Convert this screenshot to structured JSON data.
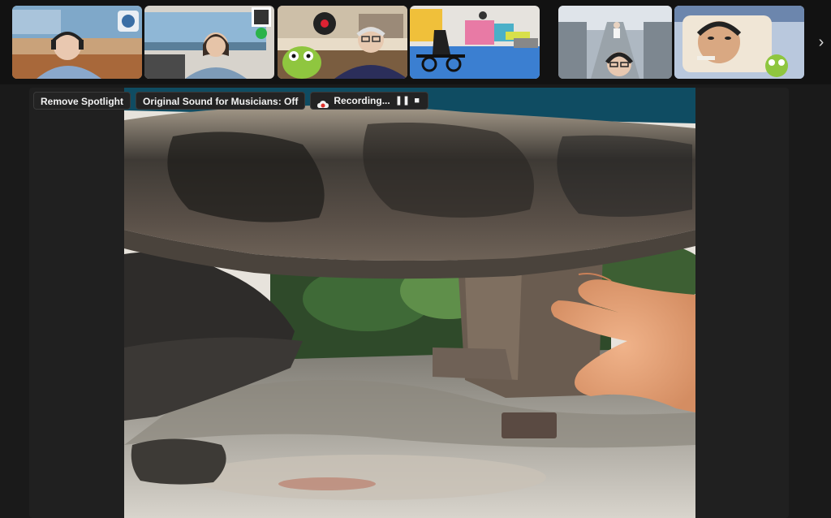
{
  "toolbar": {
    "spotlight_label": "Remove Spotlight",
    "original_sound_label": "Original Sound for Musicians: Off",
    "recording_label": "Recording...",
    "pause_symbol": "❚❚",
    "stop_symbol": "■"
  },
  "strip": {
    "next_symbol": "›",
    "tiles": [
      {
        "id": "participant-1"
      },
      {
        "id": "participant-2"
      },
      {
        "id": "participant-3"
      },
      {
        "id": "participant-4"
      },
      {
        "id": "participant-5"
      },
      {
        "id": "participant-6"
      }
    ]
  },
  "colors": {
    "background": "#1a1a1a",
    "recording_red": "#e0312b",
    "share_border": "#0f4c62"
  },
  "icons": [
    "recording-cloud-icon",
    "pause-icon",
    "stop-icon",
    "chevron-right-icon"
  ]
}
